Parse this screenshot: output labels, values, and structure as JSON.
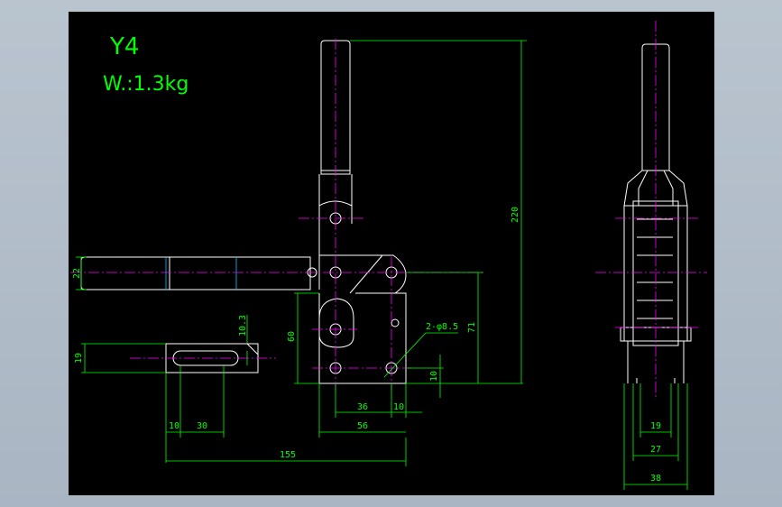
{
  "drawing": {
    "model": "Y4",
    "weight": "W.:1.3kg"
  },
  "dimensions": {
    "d22": "22",
    "d19": "19",
    "d10_3": "10.3",
    "d60": "60",
    "d71": "71",
    "d220": "220",
    "hole": "2-φ8.5",
    "d10_v": "10",
    "d36": "36",
    "d10_h": "10",
    "d56": "56",
    "d10_a": "10",
    "d30": "30",
    "d155": "155",
    "d19_side": "19",
    "d27": "27",
    "d38": "38"
  },
  "colors": {
    "background": "#000000",
    "outline": "#ffffff",
    "dimension": "#00ff00",
    "centerline": "#ff00ff",
    "hidden": "#00c8ff"
  }
}
